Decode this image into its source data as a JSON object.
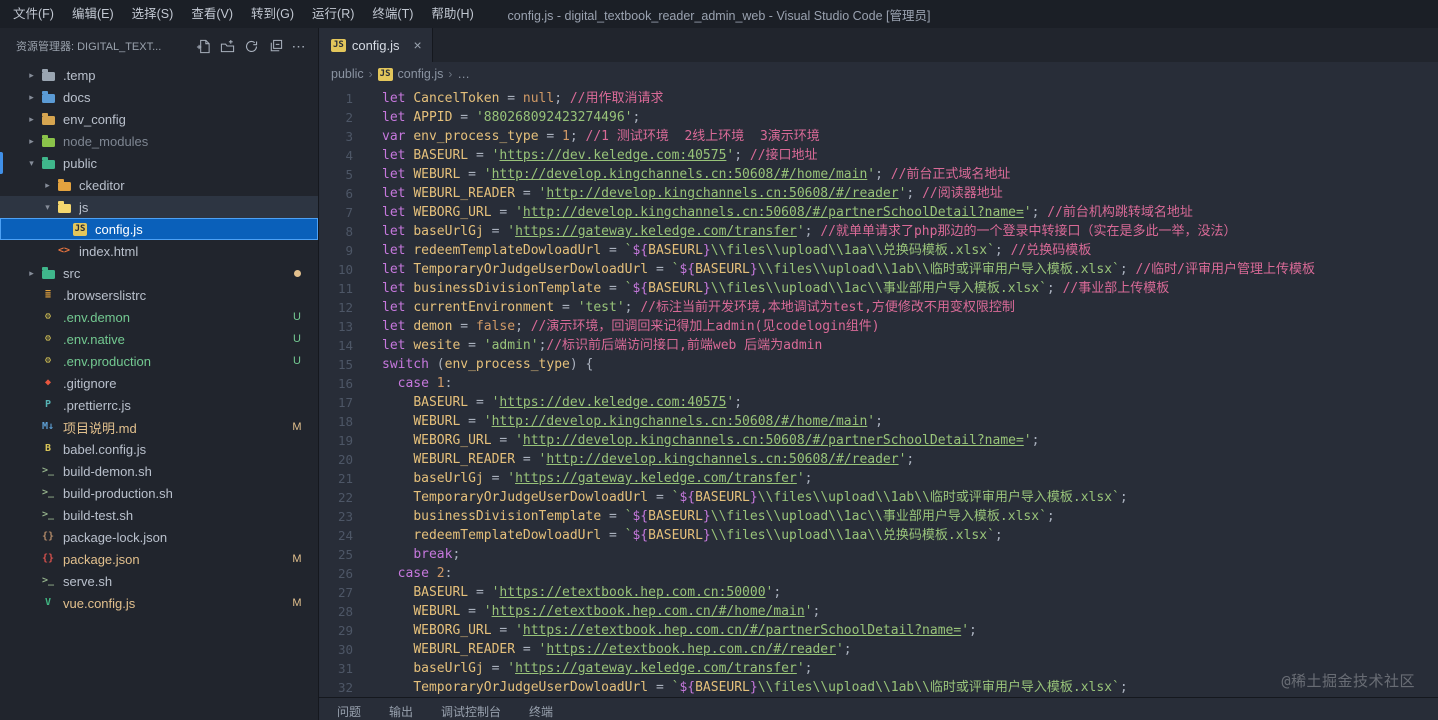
{
  "window": {
    "title": "config.js - digital_textbook_reader_admin_web - Visual Studio Code [管理员]",
    "menus": [
      "文件(F)",
      "编辑(E)",
      "选择(S)",
      "查看(V)",
      "转到(G)",
      "运行(R)",
      "终端(T)",
      "帮助(H)"
    ]
  },
  "colors": {
    "accent_selection": "#0a60ba",
    "git_untracked": "#73c991",
    "git_modified": "#e2c08d",
    "string": "#98c379",
    "keyword": "#c678dd",
    "comment": "#d96a97"
  },
  "sidebar": {
    "header": "资源管理器: DIGITAL_TEXT...",
    "fileIcons": {
      "js": {
        "glyph": "JS",
        "fg": "#2a2e37",
        "bg": "#e3c65b"
      },
      "html": {
        "glyph": "<>",
        "fg": "#e8743f"
      },
      "list": {
        "glyph": "≣",
        "fg": "#e5a43d"
      },
      "gear": {
        "glyph": "⚙",
        "fg": "#d6c455"
      },
      "git": {
        "glyph": "◆",
        "fg": "#e8573f"
      },
      "prettier": {
        "glyph": "P",
        "fg": "#56b3b4"
      },
      "md": {
        "glyph": "M↓",
        "fg": "#5d9fd4"
      },
      "babel": {
        "glyph": "B",
        "fg": "#d9c558"
      },
      "shell": {
        "glyph": ">_",
        "fg": "#93b08a"
      },
      "npm-lock": {
        "glyph": "{}",
        "fg": "#b08968"
      },
      "npm": {
        "glyph": "{}",
        "fg": "#d4504c"
      },
      "vue": {
        "glyph": "V",
        "fg": "#41b883"
      }
    },
    "tree": [
      {
        "label": ".temp",
        "kind": "folder",
        "depth": 0,
        "state": "closed",
        "color": "#9aa5b1"
      },
      {
        "label": "docs",
        "kind": "folder",
        "depth": 0,
        "state": "closed",
        "color": "#5b9bd5"
      },
      {
        "label": "env_config",
        "kind": "folder",
        "depth": 0,
        "state": "closed",
        "color": "#d6a550"
      },
      {
        "label": "node_modules",
        "kind": "folder",
        "depth": 0,
        "state": "closed",
        "color": "#8bc34a",
        "labelStyle": "ignored"
      },
      {
        "label": "public",
        "kind": "folder",
        "depth": 0,
        "state": "open",
        "color": "#3fb68b"
      },
      {
        "label": "ckeditor",
        "kind": "folder",
        "depth": 1,
        "state": "closed",
        "color": "#e2a23f"
      },
      {
        "label": "js",
        "kind": "folder",
        "depth": 1,
        "state": "open",
        "color": "#f5d76e",
        "rowStyle": "subtle"
      },
      {
        "label": "config.js",
        "kind": "file",
        "depth": 2,
        "icon": "js",
        "selected": true
      },
      {
        "label": "index.html",
        "kind": "file",
        "depth": 1,
        "icon": "html"
      },
      {
        "label": "src",
        "kind": "folder",
        "depth": 0,
        "state": "closed",
        "color": "#3fb68b",
        "dot": true
      },
      {
        "label": ".browserslistrc",
        "kind": "file",
        "depth": 0,
        "icon": "list"
      },
      {
        "label": ".env.demon",
        "kind": "file",
        "depth": 0,
        "icon": "gear",
        "badge": "U",
        "labelStyle": "untracked"
      },
      {
        "label": ".env.native",
        "kind": "file",
        "depth": 0,
        "icon": "gear",
        "badge": "U",
        "labelStyle": "untracked"
      },
      {
        "label": ".env.production",
        "kind": "file",
        "depth": 0,
        "icon": "gear",
        "badge": "U",
        "labelStyle": "untracked"
      },
      {
        "label": ".gitignore",
        "kind": "file",
        "depth": 0,
        "icon": "git"
      },
      {
        "label": ".prettierrc.js",
        "kind": "file",
        "depth": 0,
        "icon": "prettier"
      },
      {
        "label": "项目说明.md",
        "kind": "file",
        "depth": 0,
        "icon": "md",
        "badge": "M",
        "labelStyle": "modified"
      },
      {
        "label": "babel.config.js",
        "kind": "file",
        "depth": 0,
        "icon": "babel"
      },
      {
        "label": "build-demon.sh",
        "kind": "file",
        "depth": 0,
        "icon": "shell"
      },
      {
        "label": "build-production.sh",
        "kind": "file",
        "depth": 0,
        "icon": "shell"
      },
      {
        "label": "build-test.sh",
        "kind": "file",
        "depth": 0,
        "icon": "shell"
      },
      {
        "label": "package-lock.json",
        "kind": "file",
        "depth": 0,
        "icon": "npm-lock"
      },
      {
        "label": "package.json",
        "kind": "file",
        "depth": 0,
        "icon": "npm",
        "badge": "M",
        "labelStyle": "modified"
      },
      {
        "label": "serve.sh",
        "kind": "file",
        "depth": 0,
        "icon": "shell"
      },
      {
        "label": "vue.config.js",
        "kind": "file",
        "depth": 0,
        "icon": "vue",
        "badge": "M",
        "labelStyle": "modified"
      }
    ]
  },
  "editor": {
    "tab_label": "config.js",
    "breadcrumb": [
      {
        "label": "public"
      },
      {
        "label": "config.js",
        "icon": "js"
      },
      {
        "label": "…"
      }
    ],
    "lines": [
      [
        [
          "kw",
          "let "
        ],
        [
          "vr",
          "CancelToken "
        ],
        [
          "op",
          "= "
        ],
        [
          "li",
          "null"
        ],
        [
          "pu",
          "; "
        ],
        [
          "cm",
          "//用作取消请求"
        ]
      ],
      [
        [
          "kw",
          "let "
        ],
        [
          "vr",
          "APPID "
        ],
        [
          "op",
          "= "
        ],
        [
          "st",
          "'880268092423274496'"
        ],
        [
          "pu",
          ";"
        ]
      ],
      [
        [
          "kw",
          "var "
        ],
        [
          "vr",
          "env_process_type "
        ],
        [
          "op",
          "= "
        ],
        [
          "nu",
          "1"
        ],
        [
          "pu",
          "; "
        ],
        [
          "cm",
          "//1 测试环境  2线上环境  3演示环境"
        ]
      ],
      [
        [
          "kw",
          "let "
        ],
        [
          "vr",
          "BASEURL "
        ],
        [
          "op",
          "= "
        ],
        [
          "st",
          "'"
        ],
        [
          "sl",
          "https://dev.keledge.com:40575"
        ],
        [
          "st",
          "'"
        ],
        [
          "pu",
          "; "
        ],
        [
          "cm",
          "//接口地址"
        ]
      ],
      [
        [
          "kw",
          "let "
        ],
        [
          "vr",
          "WEBURL "
        ],
        [
          "op",
          "= "
        ],
        [
          "st",
          "'"
        ],
        [
          "sl",
          "http://develop.kingchannels.cn:50608/#/home/main"
        ],
        [
          "st",
          "'"
        ],
        [
          "pu",
          "; "
        ],
        [
          "cm",
          "//前台正式域名地址"
        ]
      ],
      [
        [
          "kw",
          "let "
        ],
        [
          "vr",
          "WEBURL_READER "
        ],
        [
          "op",
          "= "
        ],
        [
          "st",
          "'"
        ],
        [
          "sl",
          "http://develop.kingchannels.cn:50608/#/reader"
        ],
        [
          "st",
          "'"
        ],
        [
          "pu",
          "; "
        ],
        [
          "cm",
          "//阅读器地址"
        ]
      ],
      [
        [
          "kw",
          "let "
        ],
        [
          "vr",
          "WEBORG_URL "
        ],
        [
          "op",
          "= "
        ],
        [
          "st",
          "'"
        ],
        [
          "sl",
          "http://develop.kingchannels.cn:50608/#/partnerSchoolDetail?name="
        ],
        [
          "st",
          "'"
        ],
        [
          "pu",
          "; "
        ],
        [
          "cm",
          "//前台机构跳转域名地址"
        ]
      ],
      [
        [
          "kw",
          "let "
        ],
        [
          "vr",
          "baseUrlGj "
        ],
        [
          "op",
          "= "
        ],
        [
          "st",
          "'"
        ],
        [
          "sl",
          "https://gateway.keledge.com/transfer"
        ],
        [
          "st",
          "'"
        ],
        [
          "pu",
          "; "
        ],
        [
          "cm",
          "//就单单请求了php那边的一个登录中转接口（实在是多此一举，没法）"
        ]
      ],
      [
        [
          "kw",
          "let "
        ],
        [
          "vr",
          "redeemTemplateDowloadUrl "
        ],
        [
          "op",
          "= "
        ],
        [
          "st",
          "`"
        ],
        [
          "tx",
          "${"
        ],
        [
          "tv",
          "BASEURL"
        ],
        [
          "tx",
          "}"
        ],
        [
          "st",
          "\\\\files\\\\upload\\\\1aa\\\\兑换码模板.xlsx`"
        ],
        [
          "pu",
          "; "
        ],
        [
          "cm",
          "//兑换码模板"
        ]
      ],
      [
        [
          "kw",
          "let "
        ],
        [
          "vr",
          "TemporaryOrJudgeUserDowloadUrl "
        ],
        [
          "op",
          "= "
        ],
        [
          "st",
          "`"
        ],
        [
          "tx",
          "${"
        ],
        [
          "tv",
          "BASEURL"
        ],
        [
          "tx",
          "}"
        ],
        [
          "st",
          "\\\\files\\\\upload\\\\1ab\\\\临时或评审用户导入模板.xlsx`"
        ],
        [
          "pu",
          "; "
        ],
        [
          "cm",
          "//临时/评审用户管理上传模板"
        ]
      ],
      [
        [
          "kw",
          "let "
        ],
        [
          "vr",
          "businessDivisionTemplate "
        ],
        [
          "op",
          "= "
        ],
        [
          "st",
          "`"
        ],
        [
          "tx",
          "${"
        ],
        [
          "tv",
          "BASEURL"
        ],
        [
          "tx",
          "}"
        ],
        [
          "st",
          "\\\\files\\\\upload\\\\1ac\\\\事业部用户导入模板.xlsx`"
        ],
        [
          "pu",
          "; "
        ],
        [
          "cm",
          "//事业部上传模板"
        ]
      ],
      [
        [
          "kw",
          "let "
        ],
        [
          "vr",
          "currentEnvironment "
        ],
        [
          "op",
          "= "
        ],
        [
          "st",
          "'test'"
        ],
        [
          "pu",
          "; "
        ],
        [
          "cm",
          "//标注当前开发环境,本地调试为test,方便修改不用变权限控制"
        ]
      ],
      [
        [
          "kw",
          "let "
        ],
        [
          "vr",
          "demon "
        ],
        [
          "op",
          "= "
        ],
        [
          "li",
          "false"
        ],
        [
          "pu",
          "; "
        ],
        [
          "cm",
          "//演示环境，回调回来记得加上admin(见codelogin组件)"
        ]
      ],
      [
        [
          "kw",
          "let "
        ],
        [
          "vr",
          "wesite "
        ],
        [
          "op",
          "= "
        ],
        [
          "st",
          "'admin'"
        ],
        [
          "pu",
          ";"
        ],
        [
          "cm",
          "//标识前后端访问接口,前端web 后端为admin"
        ]
      ],
      [
        [
          "kw",
          "switch "
        ],
        [
          "pu",
          "("
        ],
        [
          "vr",
          "env_process_type"
        ],
        [
          "pu",
          ") {"
        ]
      ],
      [
        [
          "pu",
          "  "
        ],
        [
          "kw",
          "case "
        ],
        [
          "nu",
          "1"
        ],
        [
          "pu",
          ":"
        ]
      ],
      [
        [
          "pu",
          "    "
        ],
        [
          "vr",
          "BASEURL "
        ],
        [
          "op",
          "= "
        ],
        [
          "st",
          "'"
        ],
        [
          "sl",
          "https://dev.keledge.com:40575"
        ],
        [
          "st",
          "'"
        ],
        [
          "pu",
          ";"
        ]
      ],
      [
        [
          "pu",
          "    "
        ],
        [
          "vr",
          "WEBURL "
        ],
        [
          "op",
          "= "
        ],
        [
          "st",
          "'"
        ],
        [
          "sl",
          "http://develop.kingchannels.cn:50608/#/home/main"
        ],
        [
          "st",
          "'"
        ],
        [
          "pu",
          ";"
        ]
      ],
      [
        [
          "pu",
          "    "
        ],
        [
          "vr",
          "WEBORG_URL "
        ],
        [
          "op",
          "= "
        ],
        [
          "st",
          "'"
        ],
        [
          "sl",
          "http://develop.kingchannels.cn:50608/#/partnerSchoolDetail?name="
        ],
        [
          "st",
          "'"
        ],
        [
          "pu",
          ";"
        ]
      ],
      [
        [
          "pu",
          "    "
        ],
        [
          "vr",
          "WEBURL_READER "
        ],
        [
          "op",
          "= "
        ],
        [
          "st",
          "'"
        ],
        [
          "sl",
          "http://develop.kingchannels.cn:50608/#/reader"
        ],
        [
          "st",
          "'"
        ],
        [
          "pu",
          ";"
        ]
      ],
      [
        [
          "pu",
          "    "
        ],
        [
          "vr",
          "baseUrlGj "
        ],
        [
          "op",
          "= "
        ],
        [
          "st",
          "'"
        ],
        [
          "sl",
          "https://gateway.keledge.com/transfer"
        ],
        [
          "st",
          "'"
        ],
        [
          "pu",
          ";"
        ]
      ],
      [
        [
          "pu",
          "    "
        ],
        [
          "vr",
          "TemporaryOrJudgeUserDowloadUrl "
        ],
        [
          "op",
          "= "
        ],
        [
          "st",
          "`"
        ],
        [
          "tx",
          "${"
        ],
        [
          "tv",
          "BASEURL"
        ],
        [
          "tx",
          "}"
        ],
        [
          "st",
          "\\\\files\\\\upload\\\\1ab\\\\临时或评审用户导入模板.xlsx`"
        ],
        [
          "pu",
          ";"
        ]
      ],
      [
        [
          "pu",
          "    "
        ],
        [
          "vr",
          "businessDivisionTemplate "
        ],
        [
          "op",
          "= "
        ],
        [
          "st",
          "`"
        ],
        [
          "tx",
          "${"
        ],
        [
          "tv",
          "BASEURL"
        ],
        [
          "tx",
          "}"
        ],
        [
          "st",
          "\\\\files\\\\upload\\\\1ac\\\\事业部用户导入模板.xlsx`"
        ],
        [
          "pu",
          ";"
        ]
      ],
      [
        [
          "pu",
          "    "
        ],
        [
          "vr",
          "redeemTemplateDowloadUrl "
        ],
        [
          "op",
          "= "
        ],
        [
          "st",
          "`"
        ],
        [
          "tx",
          "${"
        ],
        [
          "tv",
          "BASEURL"
        ],
        [
          "tx",
          "}"
        ],
        [
          "st",
          "\\\\files\\\\upload\\\\1aa\\\\兑换码模板.xlsx`"
        ],
        [
          "pu",
          ";"
        ]
      ],
      [
        [
          "pu",
          "    "
        ],
        [
          "kw",
          "break"
        ],
        [
          "pu",
          ";"
        ]
      ],
      [
        [
          "pu",
          "  "
        ],
        [
          "kw",
          "case "
        ],
        [
          "nu",
          "2"
        ],
        [
          "pu",
          ":"
        ]
      ],
      [
        [
          "pu",
          "    "
        ],
        [
          "vr",
          "BASEURL "
        ],
        [
          "op",
          "= "
        ],
        [
          "st",
          "'"
        ],
        [
          "sl",
          "https://etextbook.hep.com.cn:50000"
        ],
        [
          "st",
          "'"
        ],
        [
          "pu",
          ";"
        ]
      ],
      [
        [
          "pu",
          "    "
        ],
        [
          "vr",
          "WEBURL "
        ],
        [
          "op",
          "= "
        ],
        [
          "st",
          "'"
        ],
        [
          "sl",
          "https://etextbook.hep.com.cn/#/home/main"
        ],
        [
          "st",
          "'"
        ],
        [
          "pu",
          ";"
        ]
      ],
      [
        [
          "pu",
          "    "
        ],
        [
          "vr",
          "WEBORG_URL "
        ],
        [
          "op",
          "= "
        ],
        [
          "st",
          "'"
        ],
        [
          "sl",
          "https://etextbook.hep.com.cn/#/partnerSchoolDetail?name="
        ],
        [
          "st",
          "'"
        ],
        [
          "pu",
          ";"
        ]
      ],
      [
        [
          "pu",
          "    "
        ],
        [
          "vr",
          "WEBURL_READER "
        ],
        [
          "op",
          "= "
        ],
        [
          "st",
          "'"
        ],
        [
          "sl",
          "https://etextbook.hep.com.cn/#/reader"
        ],
        [
          "st",
          "'"
        ],
        [
          "pu",
          ";"
        ]
      ],
      [
        [
          "pu",
          "    "
        ],
        [
          "vr",
          "baseUrlGj "
        ],
        [
          "op",
          "= "
        ],
        [
          "st",
          "'"
        ],
        [
          "sl",
          "https://gateway.keledge.com/transfer"
        ],
        [
          "st",
          "'"
        ],
        [
          "pu",
          ";"
        ]
      ],
      [
        [
          "pu",
          "    "
        ],
        [
          "vr",
          "TemporaryOrJudgeUserDowloadUrl "
        ],
        [
          "op",
          "= "
        ],
        [
          "st",
          "`"
        ],
        [
          "tx",
          "${"
        ],
        [
          "tv",
          "BASEURL"
        ],
        [
          "tx",
          "}"
        ],
        [
          "st",
          "\\\\files\\\\upload\\\\1ab\\\\临时或评审用户导入模板.xlsx`"
        ],
        [
          "pu",
          ";"
        ]
      ]
    ]
  },
  "panel": {
    "tabs": [
      "问题",
      "输出",
      "调试控制台",
      "终端"
    ]
  },
  "watermark": "@稀土掘金技术社区"
}
